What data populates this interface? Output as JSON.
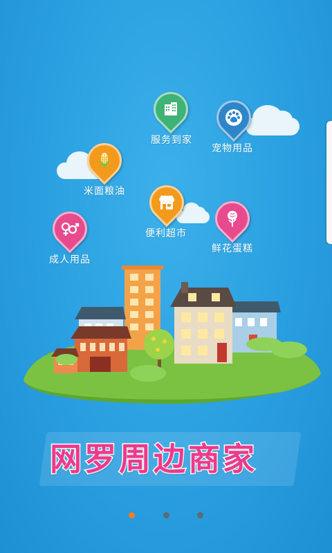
{
  "categories": [
    {
      "label": "服务到家",
      "icon": "building-icon",
      "color": "#3fb275"
    },
    {
      "label": "宠物用品",
      "icon": "paw-icon",
      "color": "#2e86c9"
    },
    {
      "label": "米面粮油",
      "icon": "corn-icon",
      "color": "#f39a1c"
    },
    {
      "label": "便利超市",
      "icon": "store-icon",
      "color": "#f39a1c"
    },
    {
      "label": "鲜花蛋糕",
      "icon": "rose-icon",
      "color": "#e84a8e"
    },
    {
      "label": "成人用品",
      "icon": "gender-icon",
      "color": "#e84a8e"
    }
  ],
  "banner": {
    "text": "网罗周边商家",
    "color": "#ec3a8c"
  },
  "pager": {
    "active_index": 0,
    "count": 3,
    "active_color": "#f07d22",
    "inactive_color": "#5a6a76"
  },
  "colors": {
    "background": "#2a9fe0",
    "grass": "#6cbf3a"
  }
}
